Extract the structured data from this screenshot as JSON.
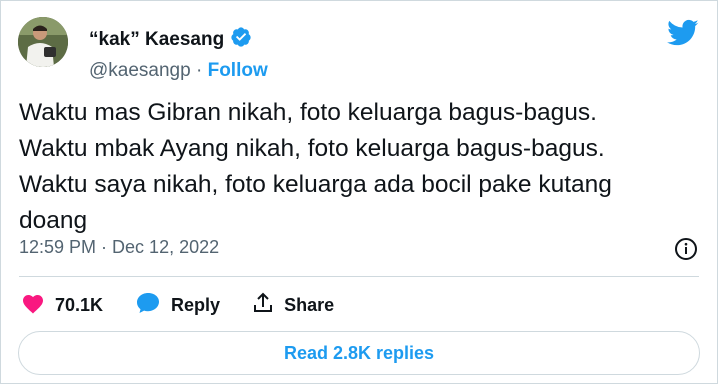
{
  "author": {
    "display_name": "“kak” Kaesang",
    "handle": "@kaesangp",
    "separator": " · ",
    "follow_label": "Follow"
  },
  "tweet": {
    "text": "Waktu mas Gibran nikah, foto keluarga bagus-bagus.\nWaktu mbak Ayang nikah, foto keluarga bagus-bagus.\nWaktu saya nikah, foto keluarga ada bocil pake kutang\ndoang",
    "timestamp": "12:59 PM · Dec 12, 2022"
  },
  "actions": {
    "likes_count": "70.1K",
    "reply_label": "Reply",
    "share_label": "Share"
  },
  "replies_button_label": "Read 2.8K replies",
  "colors": {
    "brand_blue": "#1d9bf0",
    "like_pink": "#f91880",
    "muted_text": "#536471",
    "border": "#cfd9de"
  },
  "icons": {
    "verified": "verified-badge-icon",
    "logo": "twitter-bird-icon",
    "info": "info-icon",
    "like": "heart-icon",
    "reply": "speech-bubble-icon",
    "share": "share-upload-icon"
  }
}
